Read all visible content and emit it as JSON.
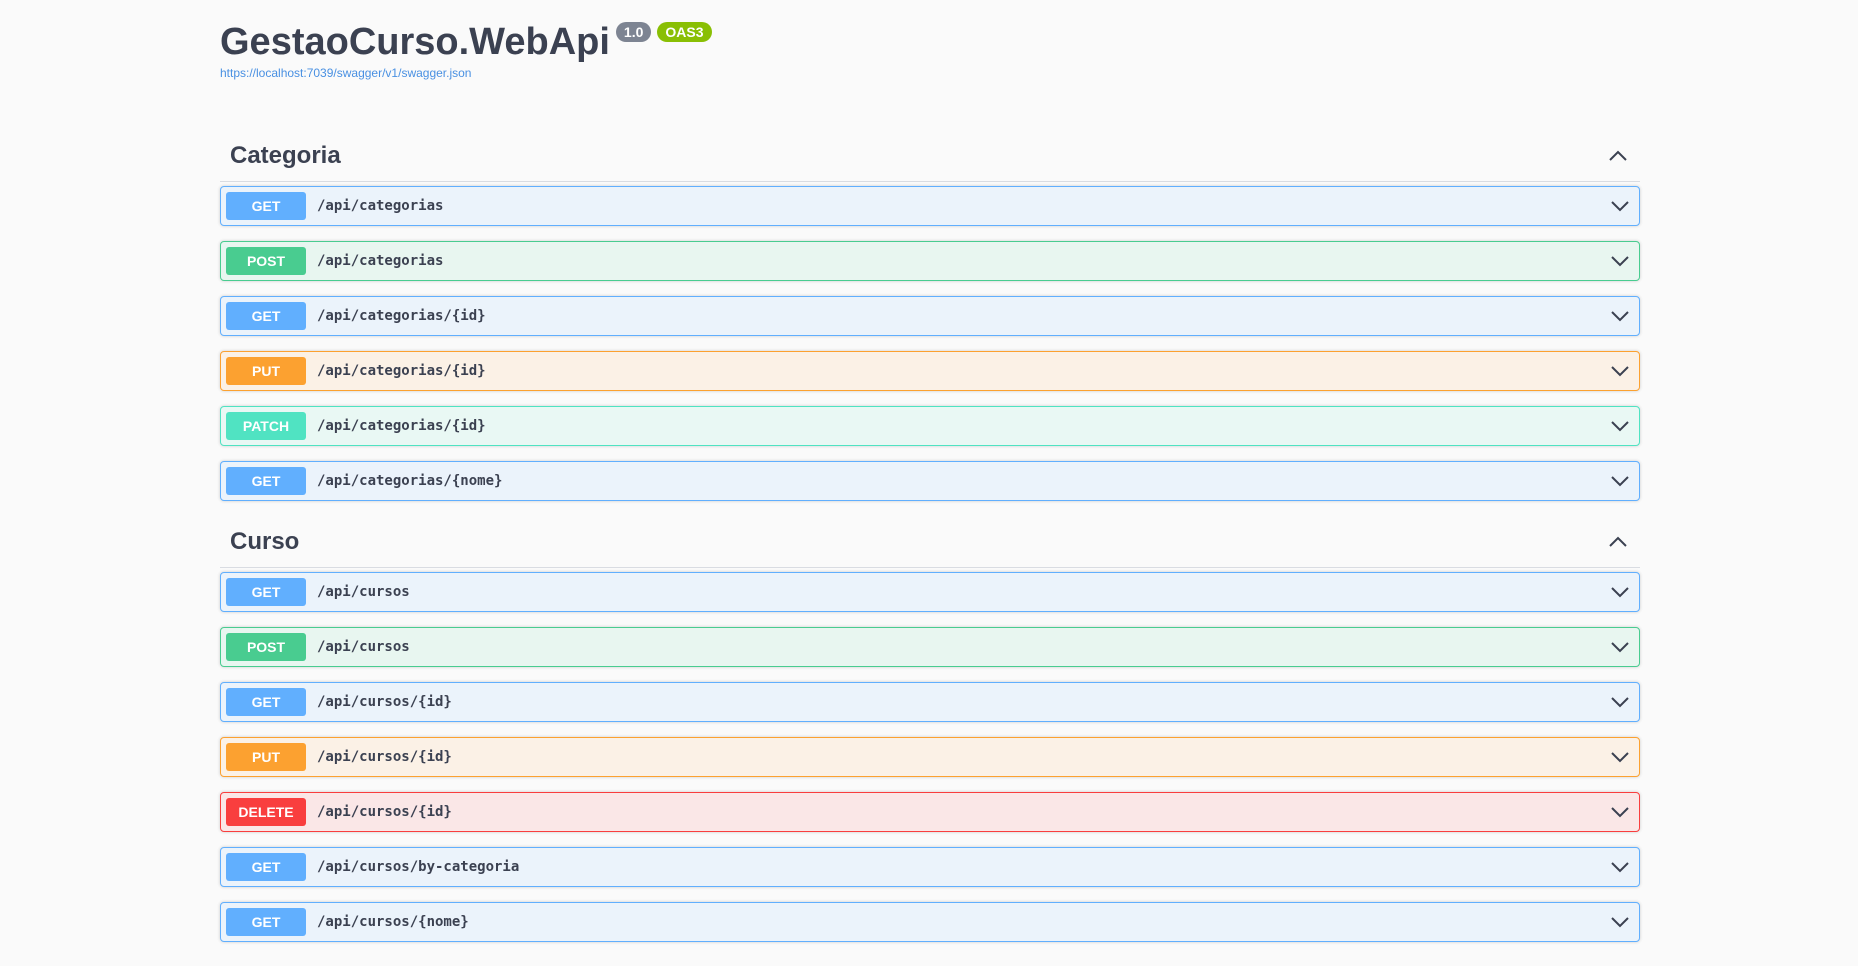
{
  "info": {
    "title": "GestaoCurso.WebApi",
    "version_badge": "1.0",
    "oas_badge": "OAS3",
    "spec_link": "https://localhost:7039/swagger/v1/swagger.json"
  },
  "colors": {
    "get": "#61affe",
    "post": "#49cc90",
    "put": "#fca130",
    "patch": "#50e3c2",
    "delete": "#f93e3e"
  },
  "tags": [
    {
      "name": "Categoria",
      "collapse_icon": "chevron-up-icon",
      "operations": [
        {
          "method": "GET",
          "path": "/api/categorias"
        },
        {
          "method": "POST",
          "path": "/api/categorias"
        },
        {
          "method": "GET",
          "path": "/api/categorias/{id}"
        },
        {
          "method": "PUT",
          "path": "/api/categorias/{id}"
        },
        {
          "method": "PATCH",
          "path": "/api/categorias/{id}"
        },
        {
          "method": "GET",
          "path": "/api/categorias/{nome}"
        }
      ]
    },
    {
      "name": "Curso",
      "collapse_icon": "chevron-up-icon",
      "operations": [
        {
          "method": "GET",
          "path": "/api/cursos"
        },
        {
          "method": "POST",
          "path": "/api/cursos"
        },
        {
          "method": "GET",
          "path": "/api/cursos/{id}"
        },
        {
          "method": "PUT",
          "path": "/api/cursos/{id}"
        },
        {
          "method": "DELETE",
          "path": "/api/cursos/{id}"
        },
        {
          "method": "GET",
          "path": "/api/cursos/by-categoria"
        },
        {
          "method": "GET",
          "path": "/api/cursos/{nome}"
        }
      ]
    }
  ]
}
